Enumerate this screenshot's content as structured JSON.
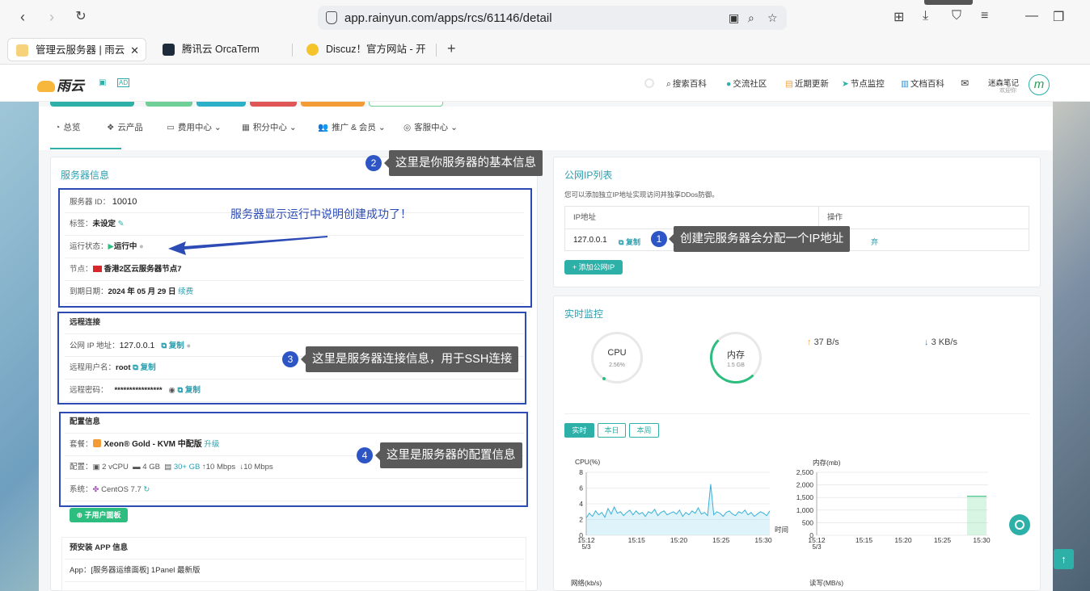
{
  "browser": {
    "url": "app.rainyun.com/apps/rcs/61146/detail",
    "tabs": [
      {
        "title": "管理云服务器 | 雨云"
      },
      {
        "title": "腾讯云 OrcaTerm"
      },
      {
        "title": "Discuz！官方网站 - 开"
      }
    ],
    "new_tab": "+"
  },
  "header": {
    "logo": "雨云",
    "links": [
      "搜索百科",
      "交流社区",
      "近期更新",
      "节点监控",
      "文档百科"
    ],
    "user_name": "迷森笔记",
    "user_sub": "欢迎你"
  },
  "menu": [
    "总览",
    "云产品",
    "费用中心",
    "积分中心",
    "推广 & 会员",
    "客服中心"
  ],
  "server_info": {
    "title": "服务器信息",
    "id_label": "服务器 ID：",
    "id_value": "10010",
    "tag_label": "标签：",
    "tag_value": "未设定",
    "status_label": "运行状态：",
    "status_value": "运行中",
    "node_label": "节点：",
    "node_value": "香港2区云服务器节点7",
    "expire_label": "到期日期：",
    "expire_value": "2024 年 05 月 29 日",
    "renew": "续费"
  },
  "remote": {
    "title": "远程连接",
    "ip_label": "公网 IP 地址：",
    "ip_value": "127.0.0.1",
    "copy": "复制",
    "user_label": "远程用户名：",
    "user_value": "root",
    "pwd_label": "远程密码：",
    "pwd_value": "****************"
  },
  "config": {
    "title": "配置信息",
    "plan_label": "套餐：",
    "plan_value": "Xeon® Gold - KVM 中配版",
    "upgrade": "升级",
    "spec_label": "配置：",
    "cpu": "2 vCPU",
    "ram": "4 GB",
    "disk": "30+ GB",
    "up": "10 Mbps",
    "down": "10 Mbps",
    "os_label": "系统：",
    "os_value": "CentOS 7.7",
    "panel_btn": "子用户面板"
  },
  "preinstall": {
    "title": "预安装 APP 信息",
    "app": "App：[服务器运维面板] 1Panel 最新版"
  },
  "ip_list": {
    "title": "公网IP列表",
    "desc": "您可以添加独立IP地址实现访问并独享DDos防御。",
    "col_ip": "IP地址",
    "col_op": "操作",
    "ip": "127.0.0.1",
    "copy": "复制",
    "op_tail": "弃",
    "add_btn": "+ 添加公网IP"
  },
  "monitor": {
    "title": "实时监控",
    "cpu_label": "CPU",
    "cpu_value": "2.56%",
    "mem_label": "内存",
    "mem_value": "1.5 GB",
    "up_rate": "37 B/s",
    "down_rate": "3 KB/s",
    "tabs": [
      "实时",
      "本日",
      "本周"
    ],
    "cpu_chart_title": "CPU(%)",
    "mem_chart_title": "内存(mb)",
    "net_title": "网络(kb/s)",
    "disk_title": "读写(MB/s)",
    "time_label": "时间"
  },
  "annotations": {
    "a1": "创建完服务器会分配一个IP地址",
    "a2": "这里是你服务器的基本信息",
    "a3": "这里是服务器连接信息，用于SSH连接",
    "a4": "这里是服务器的配置信息",
    "arrow_note": "服务器显示运行中说明创建成功了！",
    "n1": "1",
    "n2": "2",
    "n3": "3",
    "n4": "4"
  },
  "chart_data": [
    {
      "type": "line",
      "ylabel": "CPU(%)",
      "xlabel": "时间",
      "ylim": [
        0,
        8
      ],
      "yticks": [
        0,
        2,
        4,
        6,
        8
      ],
      "xticks": [
        "15:12 5/3",
        "15:15",
        "15:20",
        "15:25",
        "15:30"
      ],
      "series": [
        {
          "values": [
            2.2,
            2.8,
            2.4,
            3.1,
            2.6,
            2.9,
            2.3,
            3.4,
            2.7,
            3.6,
            2.8,
            3.0,
            2.5,
            2.9,
            3.2,
            2.6,
            3.1,
            2.7,
            2.9,
            2.4,
            3.0,
            2.8,
            3.3,
            2.5,
            2.9,
            3.1,
            2.6,
            2.8,
            3.0,
            2.7,
            3.2,
            2.4,
            2.9,
            2.6,
            3.1,
            2.8,
            3.5,
            2.7,
            2.9,
            2.5,
            6.5,
            2.6,
            3.0,
            2.8,
            2.4,
            2.9,
            3.1,
            2.7,
            2.5,
            3.0,
            2.8,
            3.2,
            2.6,
            2.9,
            2.4,
            2.7,
            3.0,
            2.8,
            2.5,
            3.1
          ]
        }
      ]
    },
    {
      "type": "area",
      "ylabel": "内存(mb)",
      "ylim": [
        0,
        2500
      ],
      "yticks": [
        0,
        500,
        1000,
        1500,
        2000,
        2500
      ],
      "xticks": [
        "15:12 5/3",
        "15:15",
        "15:20",
        "15:25",
        "15:30"
      ],
      "series": [
        {
          "values": [
            1550,
            1550
          ]
        }
      ]
    }
  ],
  "colors": {
    "accent": "#2cb0a8",
    "annot_box": "#2d4bb5",
    "tooltip": "#5a5a5a"
  }
}
